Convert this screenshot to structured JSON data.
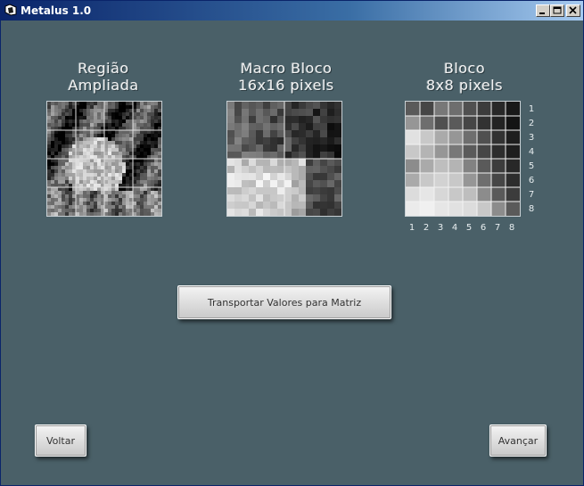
{
  "window": {
    "title": "Metalus 1.0"
  },
  "panels": {
    "regiao": {
      "line1": "Região",
      "line2": "Ampliada"
    },
    "macro": {
      "line1": "Macro Bloco",
      "line2": "16x16 pixels"
    },
    "bloco": {
      "line1": "Bloco",
      "line2": "8x8 pixels"
    }
  },
  "block_matrix": {
    "row_labels": [
      "1",
      "2",
      "3",
      "4",
      "5",
      "6",
      "7",
      "8"
    ],
    "col_labels": [
      "1",
      "2",
      "3",
      "4",
      "5",
      "6",
      "7",
      "8"
    ],
    "grays": [
      [
        90,
        70,
        120,
        110,
        80,
        60,
        40,
        25
      ],
      [
        150,
        110,
        80,
        90,
        70,
        50,
        35,
        20
      ],
      [
        225,
        200,
        170,
        150,
        110,
        80,
        50,
        30
      ],
      [
        200,
        180,
        150,
        120,
        90,
        70,
        45,
        30
      ],
      [
        140,
        170,
        190,
        180,
        130,
        90,
        60,
        40
      ],
      [
        170,
        200,
        210,
        200,
        150,
        110,
        70,
        45
      ],
      [
        220,
        230,
        215,
        200,
        190,
        140,
        90,
        60
      ],
      [
        235,
        240,
        230,
        225,
        220,
        200,
        140,
        90
      ]
    ]
  },
  "buttons": {
    "transport": "Transportar Valores para Matriz",
    "back": "Voltar",
    "next": "Avançar"
  }
}
